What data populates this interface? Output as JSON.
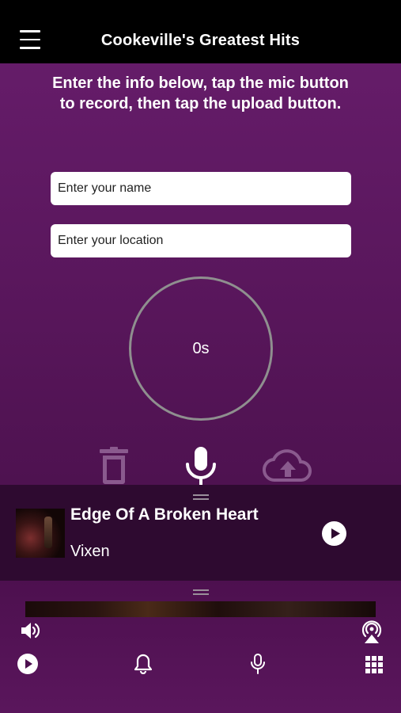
{
  "header": {
    "title": "Cookeville's Greatest Hits",
    "menu_icon": "hamburger-menu-icon"
  },
  "form": {
    "instructions": "Enter the info below, tap the mic button to record, then tap the upload button.",
    "name_placeholder": "Enter your name",
    "location_placeholder": "Enter your location",
    "timer_text": "0s"
  },
  "actions": [
    {
      "name": "trash-icon",
      "color": "#8a5a8e"
    },
    {
      "name": "microphone-icon",
      "color": "#ffffff"
    },
    {
      "name": "cloud-upload-icon",
      "color": "#8a5a8e"
    }
  ],
  "now_playing": {
    "title": "Edge Of A Broken Heart",
    "artist": "Vixen",
    "play_icon": "play-circle-icon"
  },
  "bottom_nav": {
    "volume_icon": "volume-icon",
    "cast_icon": "airplay-icon",
    "items": [
      {
        "name": "play-circle-icon"
      },
      {
        "name": "bell-icon"
      },
      {
        "name": "microphone-icon"
      },
      {
        "name": "grid-icon"
      }
    ]
  },
  "colors": {
    "header_bg": "#000000",
    "content_bg": "#651c69",
    "now_playing_bg": "#2e0a30",
    "timer_ring": "#8f8f8f",
    "muted_icon": "#8a5a8e"
  }
}
